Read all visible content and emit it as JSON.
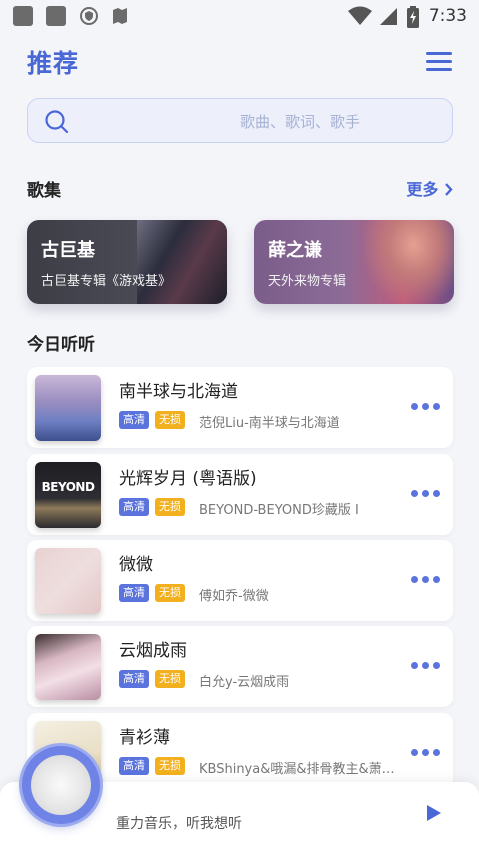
{
  "status_bar": {
    "time": "7:33"
  },
  "header": {
    "title": "推荐"
  },
  "search": {
    "placeholder": "歌曲、歌词、歌手"
  },
  "albums_section": {
    "title": "歌集",
    "more_label": "更多"
  },
  "albums": [
    {
      "name": "古巨基",
      "desc": "古巨基专辑《游戏基》"
    },
    {
      "name": "薛之谦",
      "desc": "天外来物专辑"
    }
  ],
  "today_section": {
    "title": "今日听听"
  },
  "badges": {
    "hq": "高清",
    "lossless": "无损"
  },
  "songs": [
    {
      "title": "南半球与北海道",
      "subtitle": "范倪Liu-南半球与北海道"
    },
    {
      "title": "光辉岁月 (粤语版)",
      "subtitle": "BEYOND-BEYOND珍藏版 I",
      "cover_text": "BEYOND"
    },
    {
      "title": "微微",
      "subtitle": "傅如乔-微微"
    },
    {
      "title": "云烟成雨",
      "subtitle": "白允y-云烟成雨"
    },
    {
      "title": "青衫薄",
      "subtitle": "KBShinya&哦漏&排骨教主&萧…"
    }
  ],
  "player": {
    "slogan": "重力音乐，听我想听"
  },
  "colors": {
    "accent": "#4a67d6",
    "badge_hq": "#5b74dd",
    "badge_lossless": "#f2b01e"
  }
}
